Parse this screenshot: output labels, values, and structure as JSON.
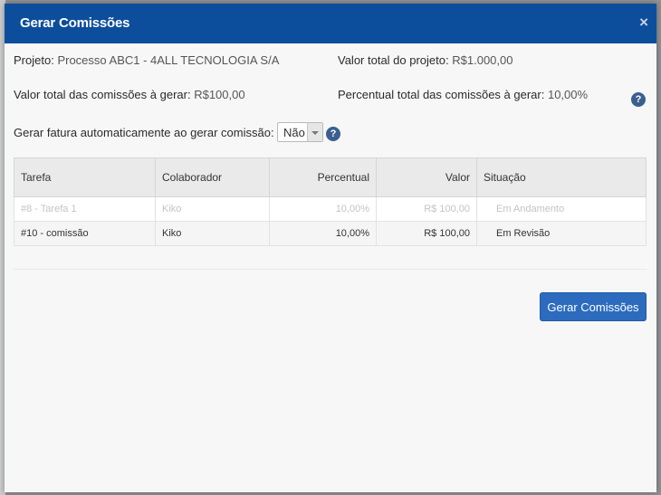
{
  "modal": {
    "title": "Gerar Comissões",
    "close_glyph": "×"
  },
  "info": {
    "projeto_label": "Projeto:",
    "projeto_value": "Processo ABC1 - 4ALL TECNOLOGIA S/A",
    "valor_total_label": "Valor total do projeto:",
    "valor_total_value": "R$1.000,00",
    "valor_comissoes_label": "Valor total das comissões à gerar:",
    "valor_comissoes_value": "R$100,00",
    "percentual_label": "Percentual total das comissões à gerar:",
    "percentual_value": "10,00%"
  },
  "fatura": {
    "label": "Gerar fatura automaticamente ao gerar comissão:",
    "selected": "Não"
  },
  "help_glyph": "?",
  "table": {
    "headers": [
      "Tarefa",
      "Colaborador",
      "Percentual",
      "Valor",
      "Situação"
    ],
    "rows": [
      [
        "#8 - Tarefa 1",
        "Kiko",
        "10,00%",
        "R$ 100,00",
        "Em Andamento"
      ],
      [
        "#10 - comissão",
        "Kiko",
        "10,00%",
        "R$ 100,00",
        "Em Revisão"
      ]
    ]
  },
  "actions": {
    "gerar_label": "Gerar Comissões"
  },
  "colors": {
    "header_bg": "#0d4e9c",
    "button_bg": "#2c6bbd",
    "help_icon": "#3a5f8f"
  },
  "icons": {
    "close": "close-icon",
    "help": "help-icon",
    "dropdown": "chevron-down-icon"
  }
}
